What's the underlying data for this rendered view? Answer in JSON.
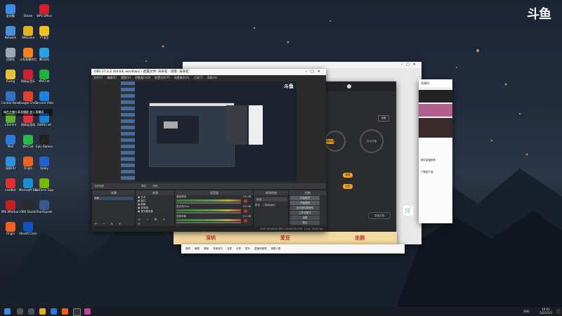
{
  "brand": "斗鱼",
  "desktop_icons": [
    {
      "label": "此电脑",
      "color": "#3c8de0"
    },
    {
      "label": "Steam",
      "color": "#1b2838"
    },
    {
      "label": "WPS Office",
      "color": "#d0202a"
    },
    {
      "label": "Network",
      "color": "#4a90d9"
    },
    {
      "label": "WeGame",
      "color": "#e0b020"
    },
    {
      "label": "YY语音",
      "color": "#f0c020"
    },
    {
      "label": "回收站",
      "color": "#9aa8b8"
    },
    {
      "label": "斗鱼直播伴侣",
      "color": "#f08020"
    },
    {
      "label": "腾讯QQ",
      "color": "#2aa0e8"
    },
    {
      "label": "Rising",
      "color": "#e8c040"
    },
    {
      "label": "网易云音乐",
      "color": "#d02030"
    },
    {
      "label": "WeChat",
      "color": "#20b040"
    },
    {
      "label": "Control Panel",
      "color": "#3070c0"
    },
    {
      "label": "Google Chrome",
      "color": "#e04030"
    },
    {
      "label": "Tencent Video",
      "color": "#2080e0"
    },
    {
      "label": "uTorrent",
      "color": "#60b030"
    },
    {
      "label": "网易云游戏",
      "color": "#e03040"
    },
    {
      "label": "Battle.net",
      "color": "#1a80d8"
    },
    {
      "label": "Mail",
      "color": "#2a7ad8"
    },
    {
      "label": "WeChat",
      "color": "#28b848"
    },
    {
      "label": "Epic Games",
      "color": "#222222"
    },
    {
      "label": "网易UU",
      "color": "#3090e0"
    },
    {
      "label": "Origin",
      "color": "#f06020"
    },
    {
      "label": "Uplay",
      "color": "#2060d0"
    },
    {
      "label": "LeetBot",
      "color": "#e03030"
    },
    {
      "label": "Microsoft Edge",
      "color": "#1a90d0"
    },
    {
      "label": "GeForce Experience",
      "color": "#76b900"
    },
    {
      "label": "MSI Afterburner",
      "color": "#c02020"
    },
    {
      "label": "OBS Studio",
      "color": "#2a2a2a"
    },
    {
      "label": "TeamSpeak",
      "color": "#3a5a8a"
    },
    {
      "label": "Origin",
      "color": "#f06020"
    },
    {
      "label": "Ubisoft Connect",
      "color": "#1050c0"
    }
  ],
  "desktop_notice": "绿色主播分享直播群 加入直播间",
  "obs": {
    "title": "OBS 27.2.2 (64-bit, windows) - 配置文件: 未命名 - 场景: 未命名",
    "menu": [
      "文件(F)",
      "编辑(E)",
      "视图(V)",
      "停靠窗口(D)",
      "配置文件(P)",
      "场景集合(S)",
      "工具(T)",
      "帮助(H)"
    ],
    "scenes_label": "场景",
    "scenes_header": "当前场景",
    "scenes": [
      "场景"
    ],
    "sources_label": "来源",
    "sources": [
      "文本",
      "窗口",
      "图像",
      "游戏源",
      "显示器采集"
    ],
    "mixer_label": "混音器",
    "mixer_tracks": [
      {
        "name": "桌面音频",
        "db": "0.0 dB"
      },
      {
        "name": "麦克风/Aux",
        "db": "0.0 dB"
      },
      {
        "name": "音频采集",
        "db": "0.0 dB"
      }
    ],
    "transitions_label": "转场特效",
    "transition_value": "淡出",
    "duration_label": "时长",
    "duration_value": "300 ms",
    "controls_label": "控制",
    "controls": [
      "开始推流",
      "开始录制",
      "启动虚拟摄像机",
      "工作室模式",
      "设置",
      "退出"
    ],
    "status": [
      "LIVE: 00:00:00",
      "REC: 00:00:00",
      "CPU: 1.2%, 30.00 fps"
    ],
    "filter_btn": "滤镜",
    "props_btn": "属性"
  },
  "dark_panel": {
    "btn1": "开始直播",
    "circle1": "一键开播",
    "circle2": "自动开播",
    "tag1": "设置",
    "tag2": "录屏",
    "tag3": "公告",
    "bottom_btn": "直播设置"
  },
  "right_window": {
    "header": "直播间",
    "items": [
      "分享",
      "热门",
      "新人"
    ],
    "footer1": "精彩直播推荐",
    "footer2": "下载客户端"
  },
  "bottom_banner": {
    "labels": [
      "深圳",
      "爱豆",
      "坐拥"
    ],
    "toolbar": [
      "美颜",
      "截图",
      "弹幕",
      "背景音乐",
      "连麦",
      "分享",
      "更多",
      "直播间管理",
      "观看人数"
    ]
  },
  "taskbar": {
    "time": "19:01",
    "date": "2022/5/3",
    "lang": "ENG"
  },
  "colors": {
    "accent": "#f0a020",
    "obs_bg": "#2b2b2b",
    "live_red": "#c0392b"
  }
}
